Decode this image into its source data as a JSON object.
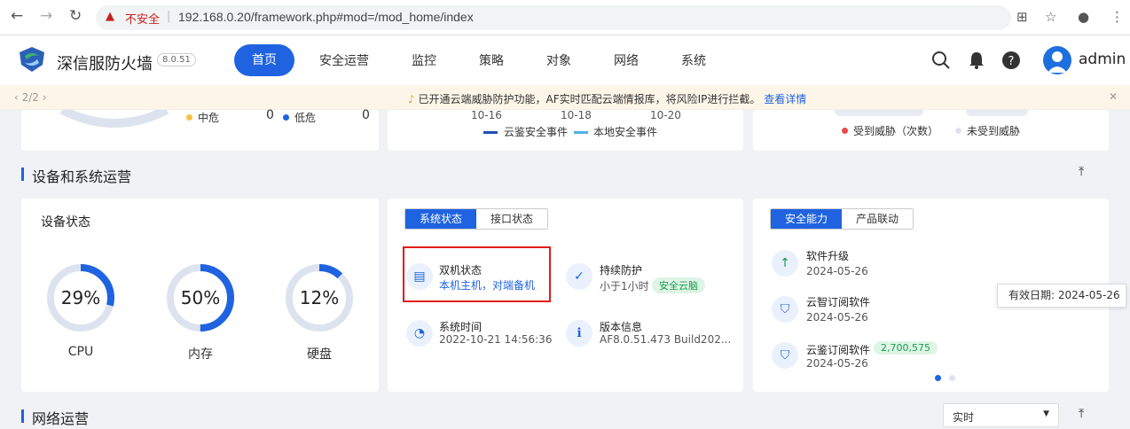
{
  "browser": {
    "url": "192.168.0.20/framework.php#mod=/mod_home/index",
    "security": "不安全"
  },
  "nav": {
    "brand": "深信服防火墙",
    "version": "8.0.51",
    "active": "首页",
    "items": [
      "安全运营",
      "监控",
      "策略",
      "对象",
      "网络",
      "系统"
    ],
    "user": "admin"
  },
  "banner": {
    "page": "2/2",
    "message": "已开通云端威胁防护功能，AF实时匹配云端情报库，将风险IP进行拦截。",
    "link": "查看详情"
  },
  "top_cards": {
    "left": {
      "mid_label": "中危",
      "mid_value": "0",
      "low_label": "低危",
      "low_value": "0"
    },
    "center": {
      "dates": [
        "10-16",
        "10-18",
        "10-20"
      ],
      "legend": [
        "云鉴安全事件",
        "本地安全事件"
      ]
    },
    "right": {
      "legend": [
        "受到威胁（次数）",
        "未受到威胁"
      ]
    }
  },
  "device_section": {
    "title": "设备和系统运营"
  },
  "device_status": {
    "title": "设备状态",
    "metrics": [
      {
        "label": "CPU",
        "percent": 29,
        "text": "29%"
      },
      {
        "label": "内存",
        "percent": 50,
        "text": "50%"
      },
      {
        "label": "硬盘",
        "percent": 12,
        "text": "12%"
      }
    ]
  },
  "system_status": {
    "tabs": [
      "系统状态",
      "接口状态"
    ],
    "items": [
      {
        "title": "双机状态",
        "value": "本机主机，对端备机"
      },
      {
        "title": "持续防护",
        "value": "小于1小时",
        "tag": "安全云脑"
      },
      {
        "title": "系统时间",
        "value": "2022-10-21 14:56:36"
      },
      {
        "title": "版本信息",
        "value": "AF8.0.51.473 Build202..."
      }
    ]
  },
  "capability": {
    "tabs": [
      "安全能力",
      "产品联动"
    ],
    "items": [
      {
        "title": "软件升级",
        "date": "2024-05-26"
      },
      {
        "title": "云智订阅软件",
        "date": "2024-05-26"
      },
      {
        "title": "云鉴订阅软件",
        "date": "2024-05-26",
        "badge": "2,700,575"
      }
    ],
    "tooltip": "有效日期: 2024-05-26"
  },
  "network_section": {
    "title": "网络运营",
    "select": "实时"
  },
  "colors": {
    "accent": "#1f63e0",
    "ring_track": "#dde3ee",
    "danger": "#e31b1b"
  }
}
